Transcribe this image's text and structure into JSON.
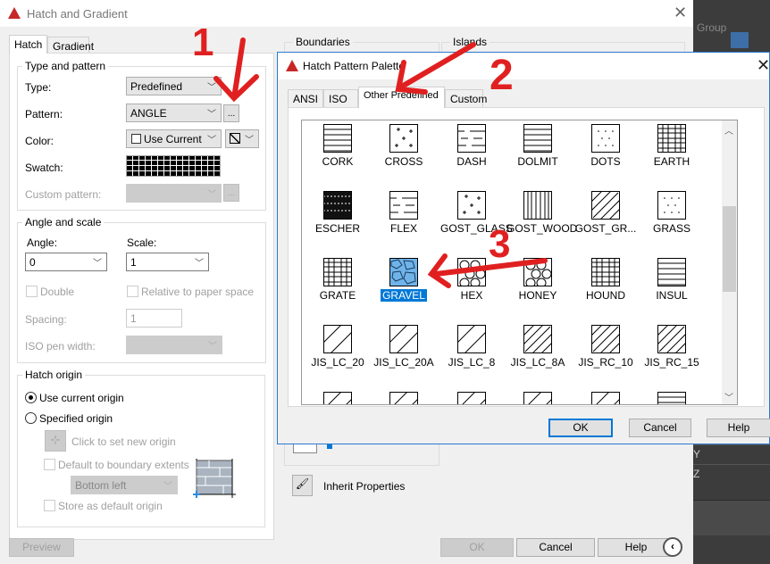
{
  "main_dialog": {
    "title": "Hatch and Gradient",
    "tabs": [
      "Hatch",
      "Gradient"
    ],
    "type_and_pattern": {
      "label": "Type and pattern",
      "type_label": "Type:",
      "type_value": "Predefined",
      "pattern_label": "Pattern:",
      "pattern_value": "ANGLE",
      "browse_label": "...",
      "color_label": "Color:",
      "color_value": "Use Current",
      "swatch_label": "Swatch:",
      "custom_pattern_label": "Custom pattern:",
      "custom_browse_label": "..."
    },
    "angle_and_scale": {
      "label": "Angle and scale",
      "angle_label": "Angle:",
      "angle_value": "0",
      "scale_label": "Scale:",
      "scale_value": "1",
      "double_label": "Double",
      "relative_label": "Relative to paper space",
      "spacing_label": "Spacing:",
      "spacing_value": "1",
      "iso_label": "ISO pen width:"
    },
    "hatch_origin": {
      "label": "Hatch origin",
      "use_current": "Use current origin",
      "specified": "Specified origin",
      "click_set": "Click to set new origin",
      "default_extents": "Default to boundary extents",
      "position_value": "Bottom left",
      "store_default": "Store as default origin"
    },
    "boundaries_label": "Boundaries",
    "islands_label": "Islands",
    "inherit_label": "Inherit Properties",
    "buttons": {
      "preview": "Preview",
      "ok": "OK",
      "cancel": "Cancel",
      "help": "Help"
    }
  },
  "palette": {
    "title": "Hatch Pattern Palette",
    "tabs": [
      "ANSI",
      "ISO",
      "Other Predefined",
      "Custom"
    ],
    "active_tab": "Other Predefined",
    "patterns": [
      {
        "name": "CORK",
        "kind": "hlines"
      },
      {
        "name": "CROSS",
        "kind": "cross"
      },
      {
        "name": "DASH",
        "kind": "dash"
      },
      {
        "name": "DOLMIT",
        "kind": "hlines"
      },
      {
        "name": "DOTS",
        "kind": "dots"
      },
      {
        "name": "EARTH",
        "kind": "grid"
      },
      {
        "name": "ESCHER",
        "kind": "dark"
      },
      {
        "name": "FLEX",
        "kind": "dash"
      },
      {
        "name": "GOST_GLASS",
        "kind": "cross"
      },
      {
        "name": "GOST_WOOD",
        "kind": "vlines"
      },
      {
        "name": "GOST_GR...",
        "kind": "diagdense"
      },
      {
        "name": "GRASS",
        "kind": "dots"
      },
      {
        "name": "GRATE",
        "kind": "grid"
      },
      {
        "name": "GRAVEL",
        "kind": "gravel",
        "selected": true
      },
      {
        "name": "HEX",
        "kind": "hex"
      },
      {
        "name": "HONEY",
        "kind": "hex"
      },
      {
        "name": "HOUND",
        "kind": "grid"
      },
      {
        "name": "INSUL",
        "kind": "hlines"
      },
      {
        "name": "JIS_LC_20",
        "kind": "diag"
      },
      {
        "name": "JIS_LC_20A",
        "kind": "diag"
      },
      {
        "name": "JIS_LC_8",
        "kind": "diag"
      },
      {
        "name": "JIS_LC_8A",
        "kind": "diagdense"
      },
      {
        "name": "JIS_RC_10",
        "kind": "diagdense"
      },
      {
        "name": "JIS_RC_15",
        "kind": "diagdense"
      },
      {
        "name": "",
        "kind": "diag"
      },
      {
        "name": "",
        "kind": "diag"
      },
      {
        "name": "",
        "kind": "diag"
      },
      {
        "name": "",
        "kind": "diag"
      },
      {
        "name": "",
        "kind": "diag"
      },
      {
        "name": "",
        "kind": "hlines"
      }
    ],
    "buttons": {
      "ok": "OK",
      "cancel": "Cancel",
      "help": "Help"
    }
  },
  "background_app": {
    "group_label": "Group",
    "axis_y": "Y",
    "axis_z": "Z"
  },
  "annotations": {
    "step1": "1",
    "step2": "2",
    "step3": "3",
    "color": "#e02020"
  },
  "colors": {
    "accent": "#0078d7",
    "selection": "#0078d7"
  }
}
